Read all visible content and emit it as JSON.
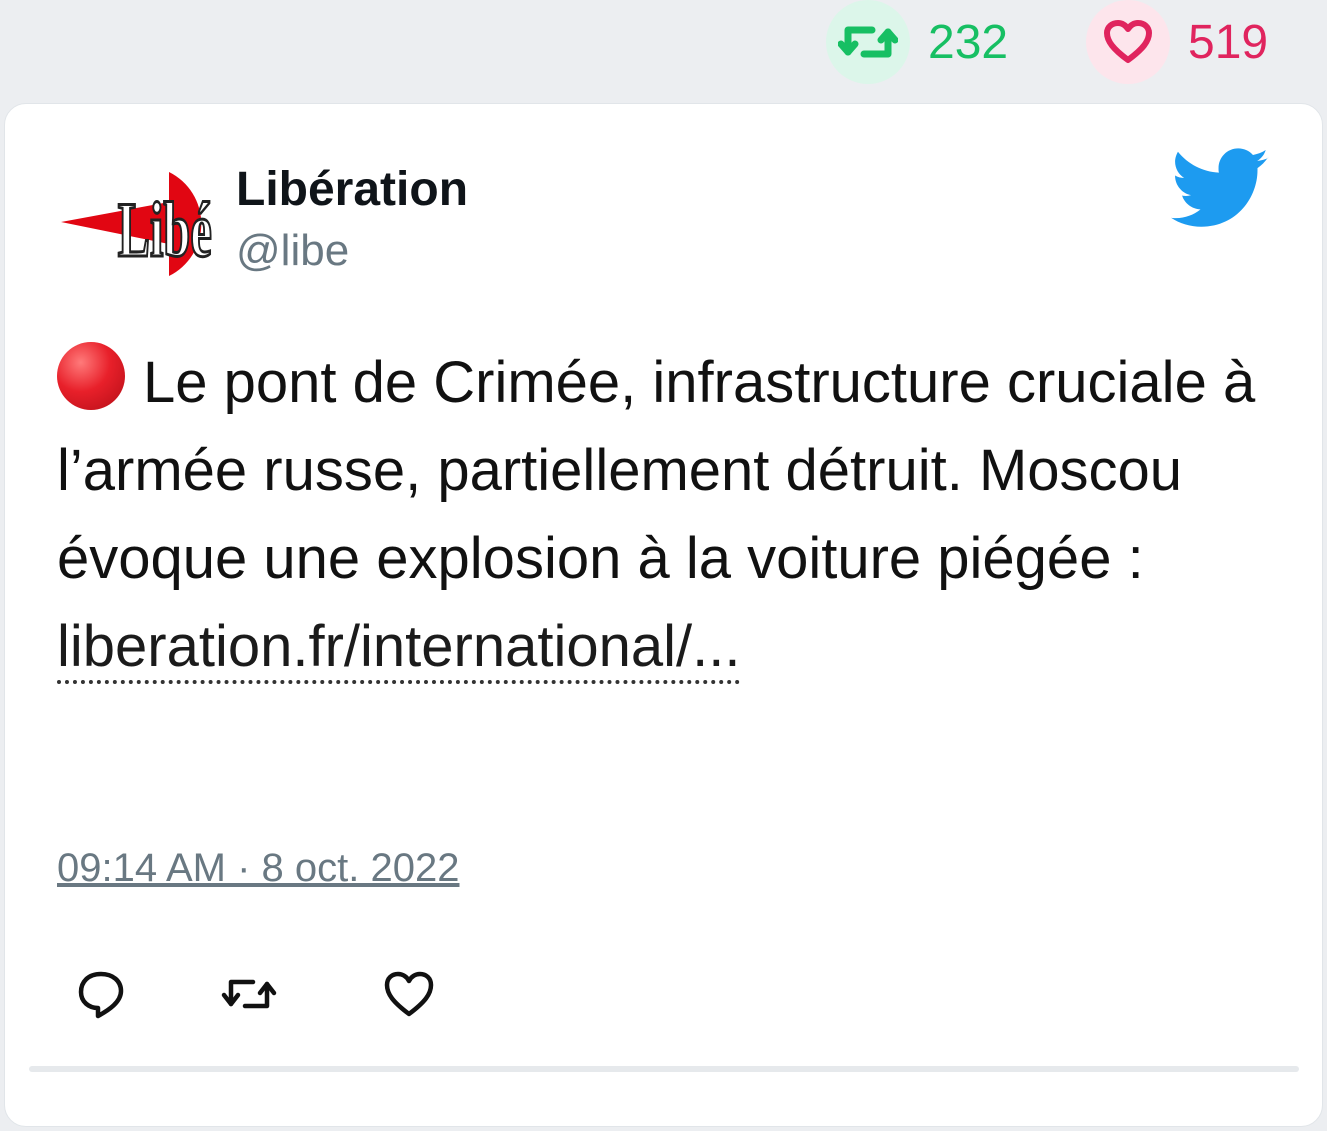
{
  "stats": {
    "retweets": "232",
    "likes": "519",
    "retweet_icon": "retweet-icon",
    "like_icon": "heart-icon",
    "retweet_color": "#17bf63",
    "like_color": "#e0245e"
  },
  "tweet": {
    "author_name": "Libération",
    "author_handle": "@libe",
    "avatar_text": "Libé",
    "brand_icon": "twitter-bird-icon",
    "brand_color": "#1d9bf0",
    "emoji": "red-circle",
    "text": "Le pont de Crimée, infrastructure cruciale à l’armée russe, partiellement détruit. Moscou évoque une explosion à la voiture piégée :",
    "link": "liberation.fr/international/...",
    "timestamp": "09:14 AM · 8 oct. 2022"
  },
  "actions": [
    {
      "icon": "reply-icon"
    },
    {
      "icon": "retweet-icon"
    },
    {
      "icon": "heart-icon"
    }
  ]
}
